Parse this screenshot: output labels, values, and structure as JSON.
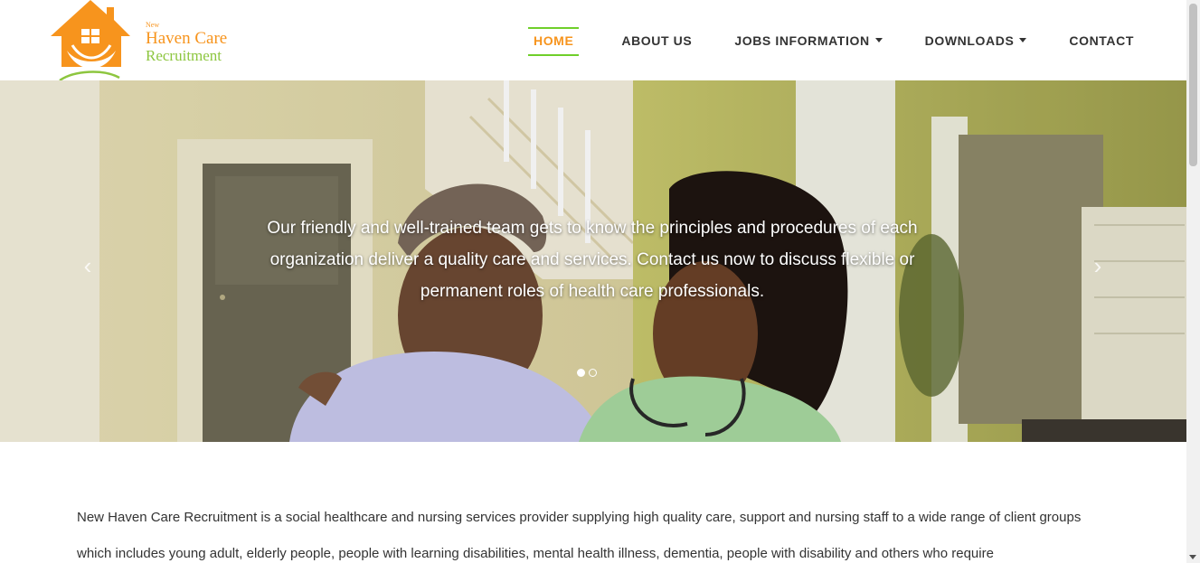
{
  "header": {
    "logo": {
      "small_word": "New",
      "name": "Haven Care",
      "subtitle": "Recruitment",
      "colors": {
        "orange": "#f7941d",
        "green": "#8dc63f"
      }
    },
    "nav": [
      {
        "label": "HOME",
        "active": true
      },
      {
        "label": "ABOUT US"
      },
      {
        "label": "JOBS INFORMATION",
        "dropdown": true
      },
      {
        "label": "DOWNLOADS",
        "dropdown": true
      },
      {
        "label": "CONTACT"
      }
    ],
    "accent_color": "#f7941d",
    "active_underline_color": "#6fcf2a"
  },
  "slider": {
    "caption": "Our friendly and well-trained team gets to know the principles and procedures of each organization deliver a quality care and services. Contact us now to discuss flexible or permanent roles of health care professionals.",
    "prev_icon": "chevron-left-icon",
    "next_icon": "chevron-right-icon",
    "slide_count": 2,
    "active_slide": 1
  },
  "intro": {
    "text": "New Haven Care Recruitment is a social healthcare and nursing services provider supplying high quality care, support and nursing staff to a wide range of client groups which includes young adult, elderly people, people with learning disabilities, mental health illness, dementia, people with disability and others who require"
  }
}
